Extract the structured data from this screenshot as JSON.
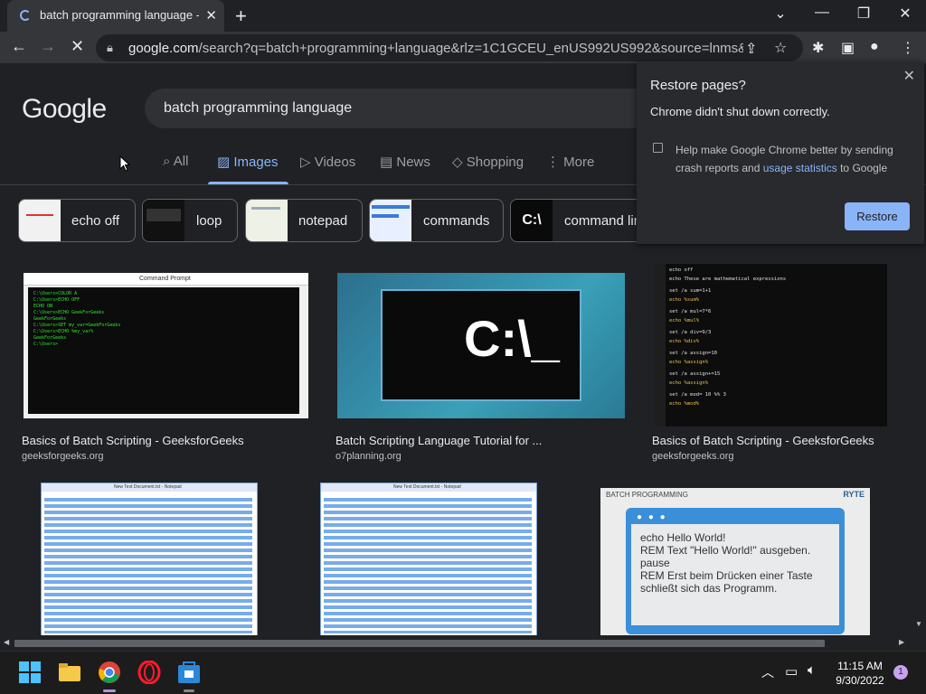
{
  "browser": {
    "tab_title": "batch programming language - Google",
    "url_host": "google.com",
    "url_rest": "/search?q=batch+programming+language&rlz=1C1GCEU_enUS992US992&source=lnms&tbm..."
  },
  "google": {
    "logo": "Google",
    "query": "batch programming language",
    "tabs": [
      "All",
      "Images",
      "Videos",
      "News",
      "Shopping",
      "More"
    ],
    "chips": [
      "echo off",
      "loop",
      "notepad",
      "commands",
      "command line"
    ],
    "results": [
      {
        "title": "Basics of Batch Scripting - GeeksforGeeks",
        "source": "geeksforgeeks.org"
      },
      {
        "title": "Batch Scripting Language Tutorial for ...",
        "source": "o7planning.org"
      },
      {
        "title": "Basics of Batch Scripting - GeeksforGeeks",
        "source": "geeksforgeeks.org"
      }
    ],
    "img1_title": "Command Prompt",
    "img1_lines": [
      "C:\\Users>COLOR A",
      "C:\\Users>ECHO OFF",
      "ECHO ON",
      "C:\\Users>ECHO GeekForGeeks",
      "GeekForGeeks",
      "C:\\Users>SET my_var=GeekForGeeks",
      "C:\\Users>ECHO %my_var%",
      "GeekForGeeks",
      "C:\\Users>"
    ],
    "img2_text": "C:\\_",
    "img3_lines": [
      "echo off",
      "echo These are mathematical expressions",
      "set /a sum=1+1",
      "echo %sum%",
      "set /a mul=7*6",
      "echo %mul%",
      "set /a div=9/3",
      "echo %div%",
      "set /a assign=10",
      "echo %assign%",
      "set /a assign+=15",
      "echo %assign%",
      "set /a mod= 10 %% 3",
      "echo %mod%"
    ],
    "img4_title": "New Text Document.txt - Notepad",
    "img5_title": "New Text Document.txt - Notepad",
    "img6_brand": "BATCH PROGRAMMING",
    "img6_logo": "RYTE",
    "img6_lines": [
      "echo Hello World!",
      "REM Text \"Hello World!\" ausgeben.",
      "pause",
      "REM Erst beim Drücken einer Taste",
      "schließt sich das Programm."
    ]
  },
  "restore_popup": {
    "title": "Restore pages?",
    "message": "Chrome didn't shut down correctly.",
    "checkbox_text_a": "Help make Google Chrome better by sending crash reports and ",
    "checkbox_link": "usage statistics",
    "checkbox_text_b": " to Google",
    "button": "Restore"
  },
  "taskbar": {
    "time": "11:15 AM",
    "date": "9/30/2022",
    "notification_count": "1"
  },
  "colors": {
    "accent": "#8ab4f8",
    "background": "#202124"
  }
}
